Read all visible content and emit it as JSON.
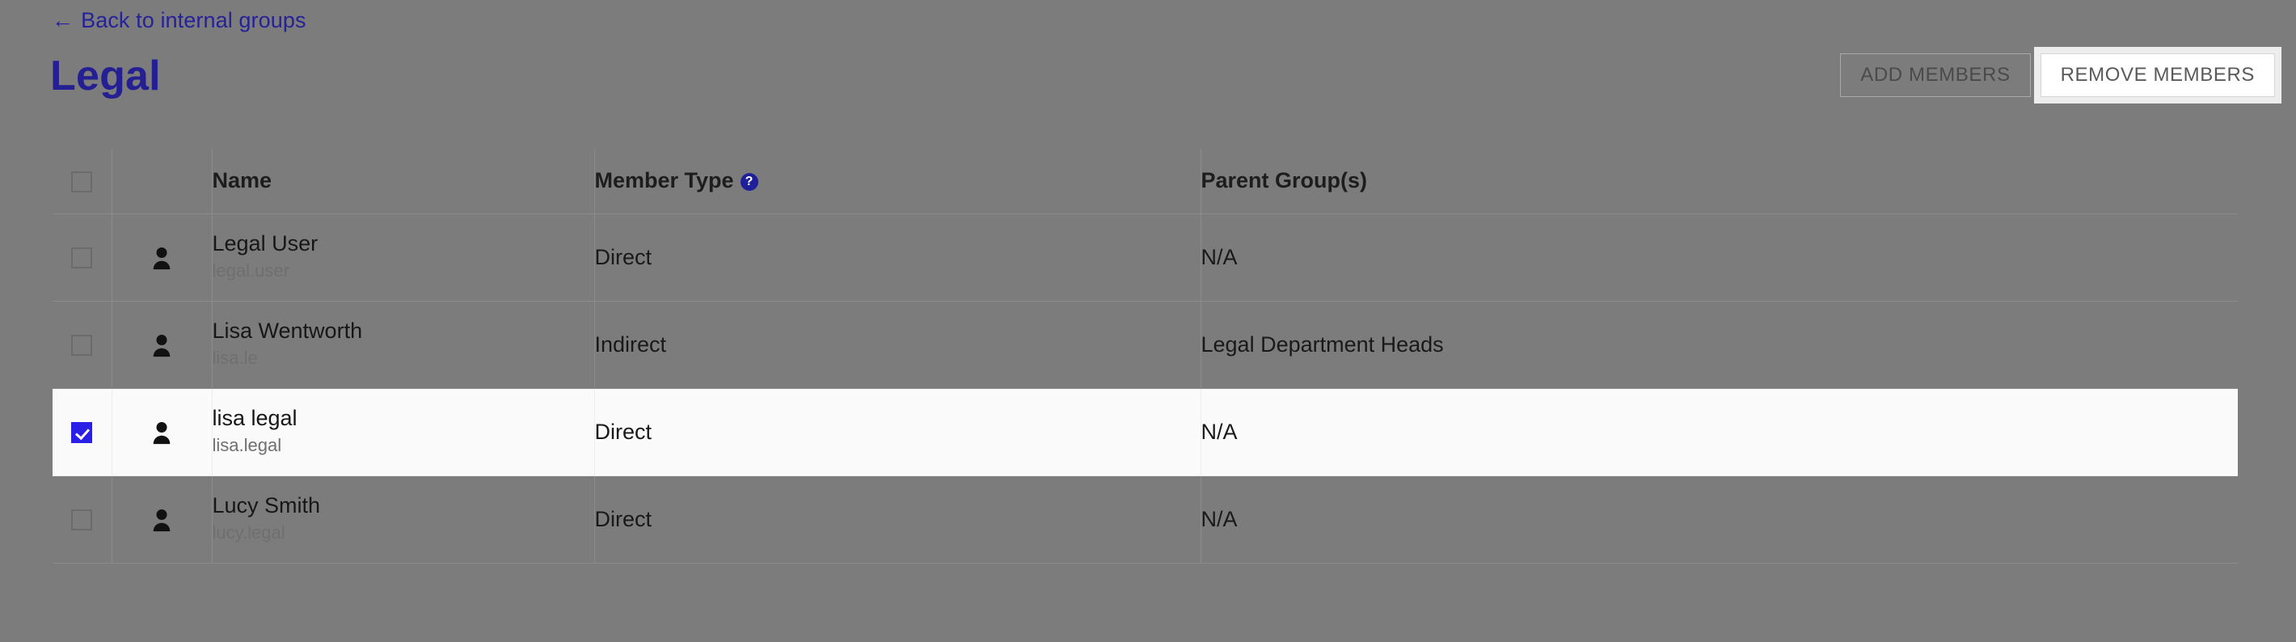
{
  "back_link": {
    "arrow": "←",
    "label": "Back to internal groups"
  },
  "page_title": "Legal",
  "toolbar": {
    "add_members_label": "ADD MEMBERS",
    "remove_members_label": "REMOVE MEMBERS"
  },
  "table": {
    "headers": {
      "select_all": "",
      "icon": "",
      "name": "Name",
      "member_type": "Member Type",
      "member_type_help": "?",
      "parent_groups": "Parent Group(s)"
    },
    "rows": [
      {
        "checked": false,
        "name": "Legal User",
        "username": "legal.user",
        "member_type": "Direct",
        "parent_groups": "N/A"
      },
      {
        "checked": false,
        "name": "Lisa Wentworth",
        "username": "lisa.le",
        "member_type": "Indirect",
        "parent_groups": "Legal Department Heads"
      },
      {
        "checked": true,
        "name": "lisa legal",
        "username": "lisa.legal",
        "member_type": "Direct",
        "parent_groups": "N/A"
      },
      {
        "checked": false,
        "name": "Lucy Smith",
        "username": "lucy.legal",
        "member_type": "Direct",
        "parent_groups": "N/A"
      }
    ]
  },
  "colors": {
    "overlay_background": "#7c7c7c",
    "link": "#252299",
    "title": "#241f93",
    "checkbox_checked": "#2a1fe6",
    "help_icon": "#1f1f9a",
    "highlight_row_background": "#fafafa",
    "focus_ring": "#ededed"
  }
}
